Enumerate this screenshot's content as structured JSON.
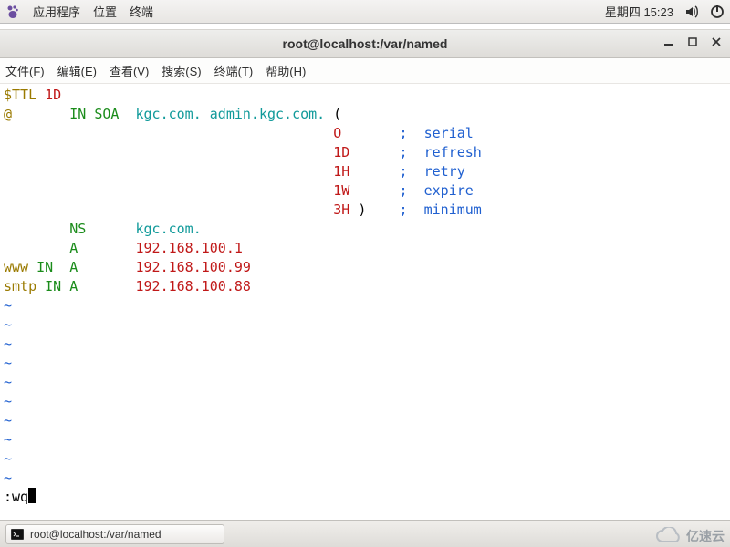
{
  "panel": {
    "app_menu": "应用程序",
    "places": "位置",
    "terminal": "终端",
    "clock": "星期四 15:23"
  },
  "window": {
    "title": "root@localhost:/var/named"
  },
  "menubar": {
    "file": "文件(F)",
    "edit": "编辑(E)",
    "view": "查看(V)",
    "search": "搜索(S)",
    "terminal": "终端(T)",
    "help": "帮助(H)"
  },
  "zone": {
    "ttl_key": "$TTL",
    "ttl_val": "1D",
    "origin": "@",
    "in": "IN",
    "soa": "SOA",
    "mname": "kgc.com.",
    "rname": "admin.kgc.com.",
    "lparen": "(",
    "rparen": ")",
    "params": [
      {
        "val": "O",
        "comment": "serial"
      },
      {
        "val": "1D",
        "comment": "refresh"
      },
      {
        "val": "1H",
        "comment": "retry"
      },
      {
        "val": "1W",
        "comment": "expire"
      },
      {
        "val": "3H",
        "comment": "minimum"
      }
    ],
    "ns": {
      "type": "NS",
      "target": "kgc.com."
    },
    "a_root": {
      "type": "A",
      "ip": "192.168.100.1"
    },
    "www": {
      "name": "www",
      "in": "IN",
      "type": "A",
      "ip": "192.168.100.99"
    },
    "smtp": {
      "name": "smtp",
      "in": "IN",
      "type": "A",
      "ip": "192.168.100.88"
    },
    "semicolon": ";"
  },
  "vim": {
    "cmd": ":wq"
  },
  "taskbar": {
    "task1": "root@localhost:/var/named"
  },
  "watermark": "亿速云"
}
